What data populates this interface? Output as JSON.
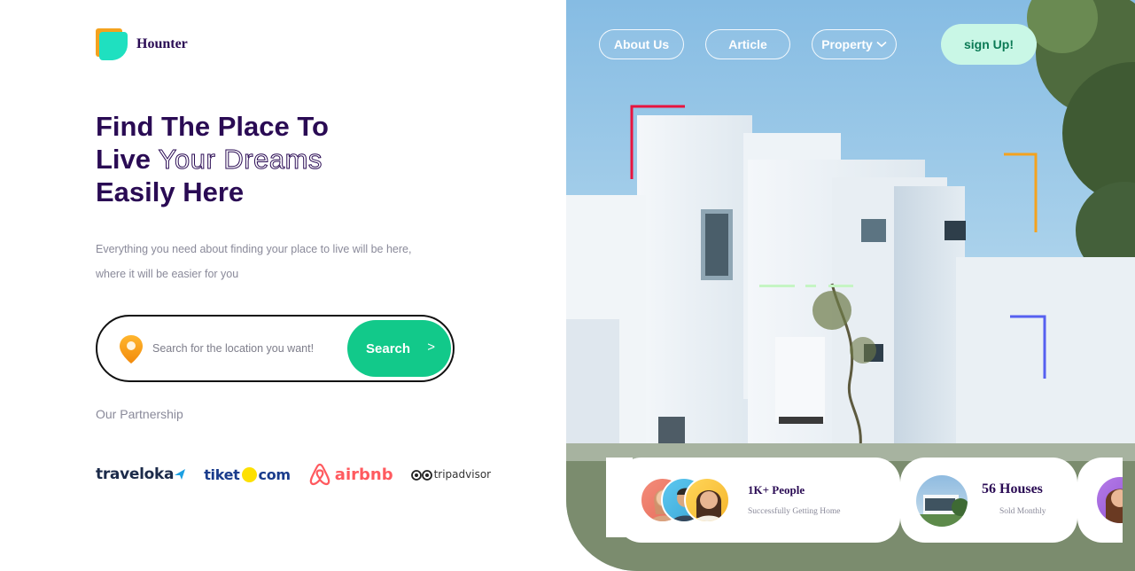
{
  "brand": {
    "name": "Hounter"
  },
  "nav": {
    "about": "About Us",
    "article": "Article",
    "property": "Property",
    "signup": "sign Up!"
  },
  "hero": {
    "line1": "Find The Place To",
    "line2_solid": "Live",
    "line2_outline": "Your Dreams",
    "line3": "Easily Here",
    "subtext_line1": "Everything you need about finding your place to live will be here,",
    "subtext_line2": "where it will be easier for you"
  },
  "search": {
    "placeholder": "Search for the location you want!",
    "button_label": "Search",
    "button_chevron": ">"
  },
  "partnership": {
    "label": "Our Partnership",
    "partners": [
      "traveloka",
      "tiket",
      "com",
      "airbnb",
      "tripadvisor"
    ]
  },
  "stats": {
    "people_title": "1K+ People",
    "people_sub": "Successfully Getting Home",
    "houses_title": "56 Houses",
    "houses_sub": "Sold Monthly"
  },
  "colors": {
    "brand_dark": "#2a0b54",
    "accent_green": "#12c98a",
    "logo_orange": "#f4a21e",
    "logo_teal": "#1fe0c0",
    "signup_bg": "#c9f7e6"
  },
  "icons": [
    "location-pin-icon",
    "chevron-right-icon",
    "chevron-down-icon"
  ]
}
